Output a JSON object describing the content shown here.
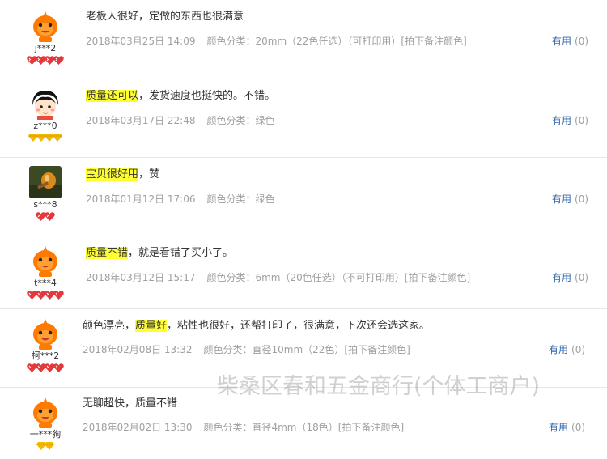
{
  "colors": {
    "highlight": "#ffff33",
    "useful_link": "#3366aa",
    "meta_text": "#a0a0a0",
    "badge_red": "#e4393c",
    "badge_gold": "#f5b800"
  },
  "useful_label": "有用",
  "reviews": [
    {
      "nick": "j***2",
      "avatar": "orange-mascot-avatar",
      "badge_type": "red-heart",
      "badge_count": 4,
      "content_parts": [
        {
          "text": "老板人很好，定做的东西也很满意",
          "hl": false
        }
      ],
      "date": "2018年03月25日 14:09",
      "spec": "颜色分类：20mm（22色任选）（可打印用）[拍下备注颜色]",
      "useful_count": "(0)"
    },
    {
      "nick": "z***0",
      "avatar": "cartoon-girl-avatar",
      "badge_type": "gold-diamond",
      "badge_count": 4,
      "content_parts": [
        {
          "text": "质量还可以",
          "hl": true
        },
        {
          "text": "，发货速度也挺快的。不错。",
          "hl": false
        }
      ],
      "date": "2018年03月17日 22:48",
      "spec": "颜色分类：绿色",
      "useful_count": "(0)"
    },
    {
      "nick": "s***8",
      "avatar": "photo-avatar",
      "badge_type": "red-heart",
      "badge_count": 2,
      "content_parts": [
        {
          "text": "宝贝很好用",
          "hl": true
        },
        {
          "text": "，赞",
          "hl": false
        }
      ],
      "date": "2018年01月12日 17:06",
      "spec": "颜色分类：绿色",
      "useful_count": "(0)"
    },
    {
      "nick": "t***4",
      "avatar": "orange-mascot-avatar",
      "badge_type": "red-heart",
      "badge_count": 4,
      "content_parts": [
        {
          "text": "质量不错",
          "hl": true
        },
        {
          "text": "，就是看错了买小了。",
          "hl": false
        }
      ],
      "date": "2018年03月12日 15:17",
      "spec": "颜色分类：6mm（20色任选）（不可打印用）[拍下备注颜色]",
      "useful_count": "(0)"
    },
    {
      "nick": "柯***2",
      "avatar": "orange-mascot-avatar",
      "badge_type": "red-heart",
      "badge_count": 4,
      "content_parts": [
        {
          "text": "颜色漂亮，",
          "hl": false
        },
        {
          "text": "质量好",
          "hl": true
        },
        {
          "text": "，粘性也很好，还帮打印了，很满意，下次还会选这家。",
          "hl": false
        }
      ],
      "date": "2018年02月08日 13:32",
      "spec": "颜色分类：直径10mm（22色）[拍下备注颜色]",
      "useful_count": "(0)"
    },
    {
      "nick": "一***狗",
      "avatar": "orange-mascot-avatar",
      "badge_type": "gold-diamond",
      "badge_count": 2,
      "content_parts": [
        {
          "text": "无聊超快，质量不错",
          "hl": false
        }
      ],
      "date": "2018年02月02日 13:30",
      "spec": "颜色分类：直径4mm（18色）[拍下备注颜色]",
      "useful_count": "(0)"
    }
  ],
  "watermark": "柴桑区春和五金商行(个体工商户)"
}
